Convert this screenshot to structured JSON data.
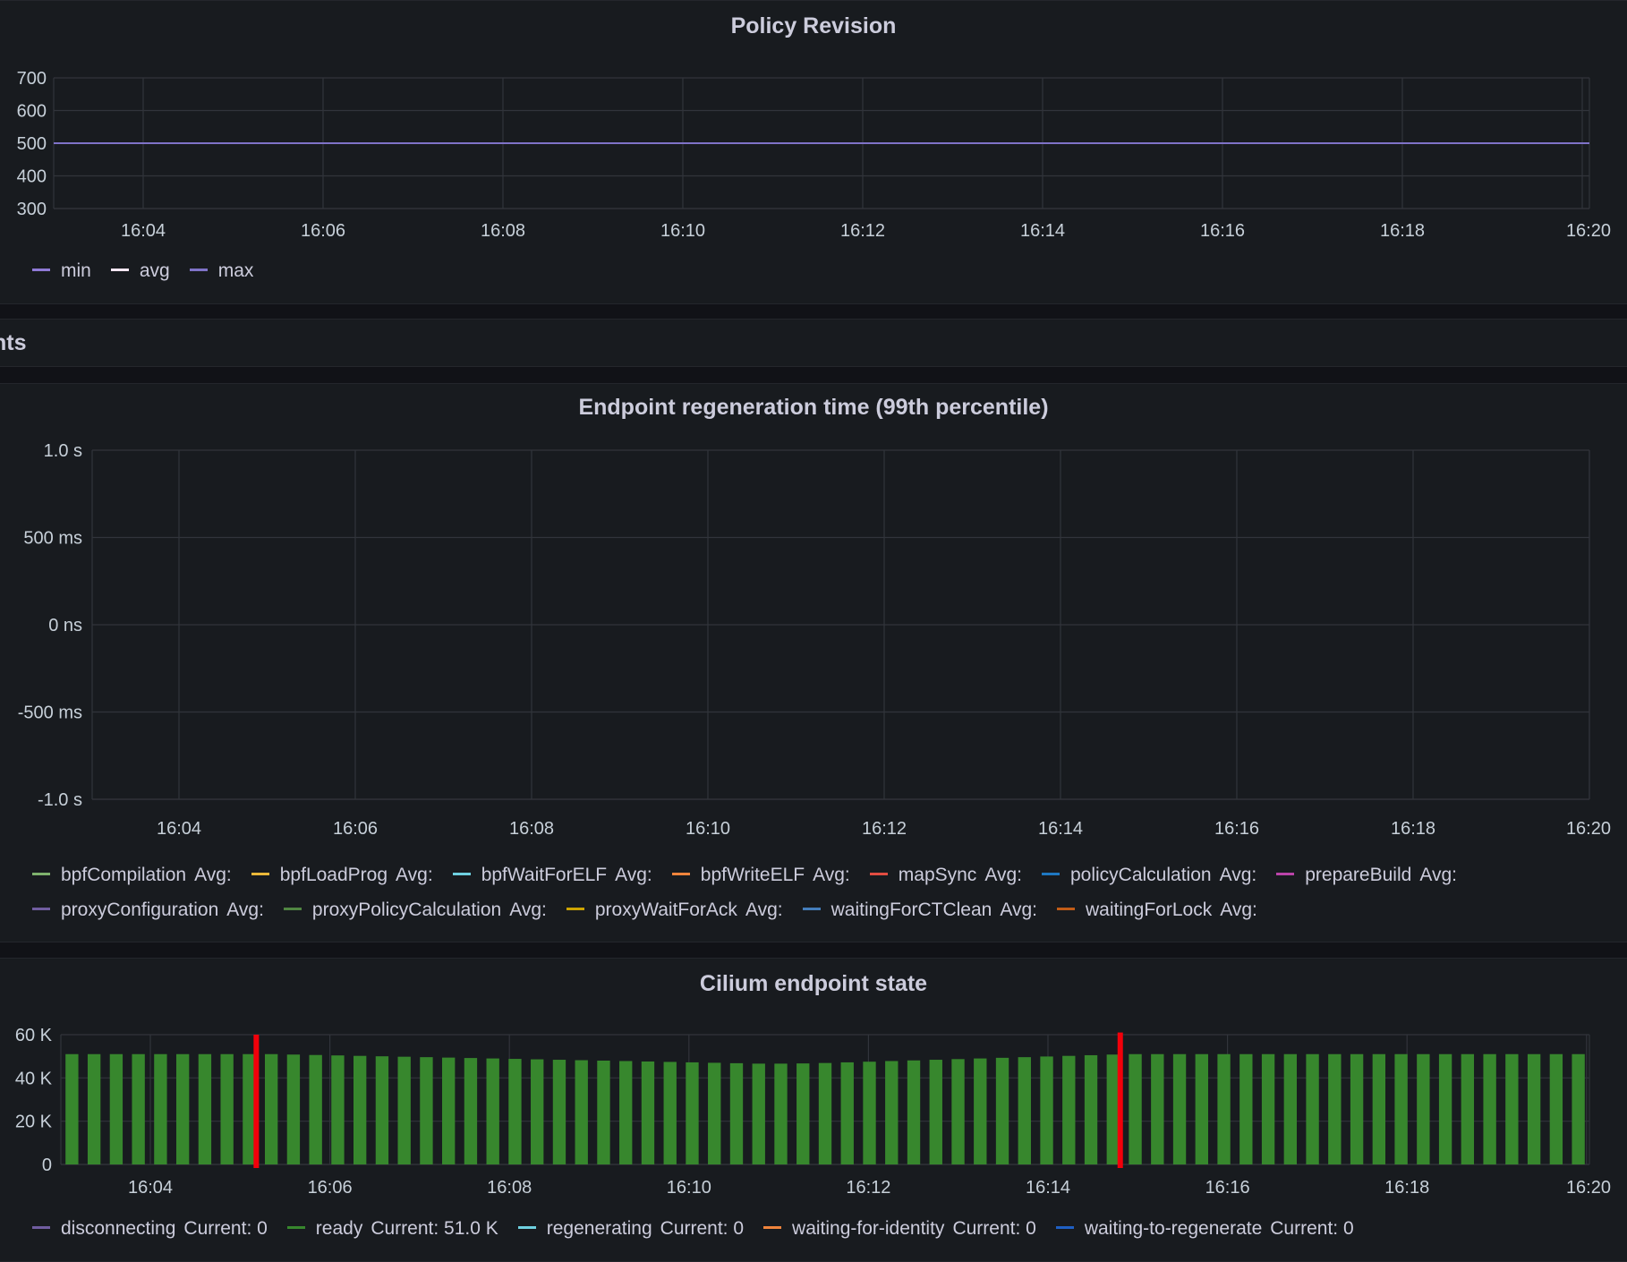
{
  "colors": {
    "grid": "#31343b",
    "axis_text": "#c7d0d9",
    "ready": "#37872d",
    "marker": "#f2000a"
  },
  "panels": {
    "policy": {
      "title": "Policy Revision",
      "legend": [
        {
          "name": "min",
          "color": "#8f7ad6"
        },
        {
          "name": "avg",
          "color": "#f5e6f2"
        },
        {
          "name": "max",
          "color": "#7f73c8"
        }
      ]
    },
    "row_title": "nts",
    "regen": {
      "title": "Endpoint regeneration time (99th percentile)",
      "legend_rows": [
        [
          {
            "name": "bpfCompilation",
            "stat": "Avg:",
            "color": "#7eb26d"
          },
          {
            "name": "bpfLoadProg",
            "stat": "Avg:",
            "color": "#eab839"
          },
          {
            "name": "bpfWaitForELF",
            "stat": "Avg:",
            "color": "#6ed0e0"
          },
          {
            "name": "bpfWriteELF",
            "stat": "Avg:",
            "color": "#ef843c"
          },
          {
            "name": "mapSync",
            "stat": "Avg:",
            "color": "#e24d42"
          },
          {
            "name": "policyCalculation",
            "stat": "Avg:",
            "color": "#1f78c1"
          },
          {
            "name": "prepareBuild",
            "stat": "Avg:",
            "color": "#ba43a9"
          }
        ],
        [
          {
            "name": "proxyConfiguration",
            "stat": "Avg:",
            "color": "#705da0"
          },
          {
            "name": "proxyPolicyCalculation",
            "stat": "Avg:",
            "color": "#508642"
          },
          {
            "name": "proxyWaitForAck",
            "stat": "Avg:",
            "color": "#cca300"
          },
          {
            "name": "waitingForCTClean",
            "stat": "Avg:",
            "color": "#447ebc"
          },
          {
            "name": "waitingForLock",
            "stat": "Avg:",
            "color": "#c15c17"
          }
        ]
      ]
    },
    "state": {
      "title": "Cilium endpoint state",
      "legend": [
        {
          "name": "disconnecting",
          "stat": "Current: 0",
          "color": "#705da0"
        },
        {
          "name": "ready",
          "stat": "Current: 51.0 K",
          "color": "#37872d"
        },
        {
          "name": "regenerating",
          "stat": "Current: 0",
          "color": "#6ed0e0"
        },
        {
          "name": "waiting-for-identity",
          "stat": "Current: 0",
          "color": "#ef843c"
        },
        {
          "name": "waiting-to-regenerate",
          "stat": "Current: 0",
          "color": "#1f60c4"
        }
      ]
    }
  },
  "chart_data": [
    {
      "type": "line",
      "title": "Policy Revision",
      "x_ticks": [
        "16:04",
        "16:06",
        "16:08",
        "16:10",
        "16:12",
        "16:14",
        "16:16",
        "16:18",
        "16:20"
      ],
      "x_range": [
        "16:03",
        "16:20"
      ],
      "y_ticks": [
        "700",
        "600",
        "500",
        "400",
        "300"
      ],
      "ylim": [
        300,
        700
      ],
      "series": [
        {
          "name": "min",
          "values_constant": 500
        },
        {
          "name": "avg",
          "values_constant": 500
        },
        {
          "name": "max",
          "values_constant": 500
        }
      ],
      "grid": true,
      "legend_position": "bottom-left"
    },
    {
      "type": "line",
      "title": "Endpoint regeneration time (99th percentile)",
      "x_ticks": [
        "16:04",
        "16:06",
        "16:08",
        "16:10",
        "16:12",
        "16:14",
        "16:16",
        "16:18",
        "16:20"
      ],
      "y_ticks": [
        "1.0 s",
        "500 ms",
        "0 ns",
        "-500 ms",
        "-1.0 s"
      ],
      "series": [],
      "grid": true,
      "legend_position": "bottom-left"
    },
    {
      "type": "bar",
      "title": "Cilium endpoint state",
      "x_ticks": [
        "16:04",
        "16:06",
        "16:08",
        "16:10",
        "16:12",
        "16:14",
        "16:16",
        "16:18",
        "16:20"
      ],
      "y_ticks": [
        "60 K",
        "40 K",
        "20 K",
        "0"
      ],
      "ylim": [
        0,
        60000
      ],
      "series": [
        {
          "name": "ready",
          "values": [
            51000,
            51000,
            51000,
            51000,
            51000,
            51000,
            51000,
            51000,
            51000,
            51000,
            50800,
            50600,
            50400,
            50200,
            50000,
            49800,
            49600,
            49400,
            49200,
            49000,
            48800,
            48600,
            48400,
            48200,
            48000,
            47800,
            47600,
            47400,
            47200,
            47000,
            46800,
            46600,
            46600,
            46700,
            46900,
            47200,
            47500,
            47800,
            48100,
            48400,
            48700,
            49000,
            49300,
            49600,
            49900,
            50200,
            50500,
            50800,
            51000,
            51000,
            51000,
            51000,
            51000,
            51000,
            51000,
            51000,
            51000,
            51000,
            51000,
            51000,
            51000,
            51000,
            51000,
            51000,
            51000,
            51000,
            51000,
            51000,
            51000
          ]
        }
      ],
      "markers": [
        {
          "at_bar_index": 8,
          "value": 60000
        },
        {
          "at_bar_index": 47,
          "value": 61000
        }
      ],
      "grid": true,
      "legend_position": "bottom-left"
    }
  ]
}
